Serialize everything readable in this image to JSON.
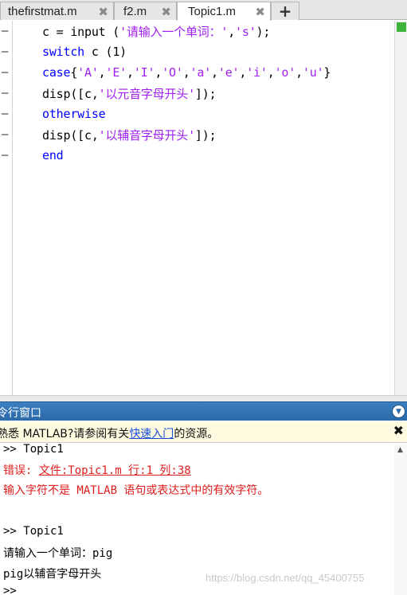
{
  "tabs": [
    {
      "label": "thefirstmat.m",
      "close": "✖"
    },
    {
      "label": "f2.m",
      "close": "✖"
    },
    {
      "label": "Topic1.m",
      "close": "✖"
    }
  ],
  "tab_add": "+",
  "editor": {
    "gutter_mark": "—",
    "lines": [
      {
        "parts": [
          "c = input (",
          "'请输入一个单词：'",
          ",",
          "'s'",
          ");"
        ]
      },
      {
        "parts": [
          "switch",
          " c (1)"
        ]
      },
      {
        "parts": [
          "case",
          "{",
          "'A'",
          ",",
          "'E'",
          ",",
          "'I'",
          ",",
          "'O'",
          ",",
          "'a'",
          ",",
          "'e'",
          ",",
          "'i'",
          ",",
          "'o'",
          ",",
          "'u'",
          "}"
        ]
      },
      {
        "parts": [
          "disp([c,",
          "'以元音字母开头'",
          "]);"
        ]
      },
      {
        "parts": [
          "otherwise"
        ]
      },
      {
        "parts": [
          "disp([c,",
          "'以辅音字母开头'",
          "]);"
        ]
      },
      {
        "parts": [
          "end"
        ]
      }
    ]
  },
  "command_window": {
    "title": "令行窗口",
    "info_prefix": "熟悉 MATLAB?请参阅有关",
    "info_link": "快速入门",
    "info_suffix": "的资源。",
    "info_close": "✖",
    "menu_icon": "▼",
    "lines": [
      {
        "text": ">> Topic1",
        "type": "normal"
      },
      {
        "text_prefix": "错误: ",
        "text_link": "文件:Topic1.m 行:1 列:38",
        "type": "error-link"
      },
      {
        "text": "输入字符不是 MATLAB 语句或表达式中的有效字符。",
        "type": "error"
      },
      {
        "text": "",
        "type": "normal"
      },
      {
        "text": ">> Topic1",
        "type": "normal"
      },
      {
        "text": "请输入一个单词：pig",
        "type": "normal"
      },
      {
        "text": "pig以辅音字母开头",
        "type": "normal"
      },
      {
        "text": ">>",
        "type": "normal"
      }
    ],
    "watermark": "https://blog.csdn.net/qq_45400755"
  },
  "colors": {
    "keyword": "#0000ff",
    "string": "#a020f0",
    "error": "#e01c1c",
    "status_ok": "#3db33a",
    "titlebar": "#2c6aa8"
  }
}
